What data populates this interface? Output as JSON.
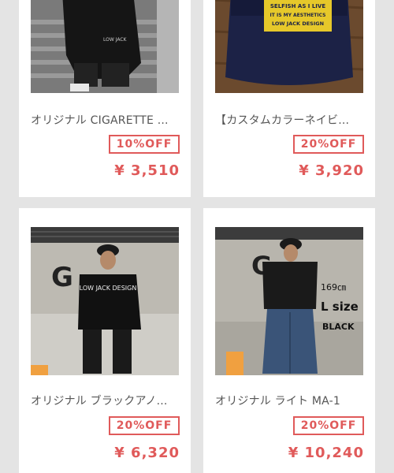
{
  "products": [
    {
      "title": "オリジナル CIGARETTE ...",
      "discount": "10%OFF",
      "price": "¥ 3,510"
    },
    {
      "title": "【カスタムカラーネイビ...",
      "discount": "20%OFF",
      "price": "¥ 3,920",
      "cap_text": [
        "SELFISH AS I LIVE",
        "IT IS MY AESTHETICS",
        "LOW JACK DESIGN"
      ]
    },
    {
      "title": "オリジナル ブラックアノ...",
      "discount": "20%OFF",
      "price": "¥ 6,320",
      "photo_text": "LOW JACK DESIGN",
      "wall_letter": "G"
    },
    {
      "title": "オリジナル ライト MA-1",
      "discount": "20%OFF",
      "price": "¥ 10,240",
      "wall_letter": "G",
      "model_height": "169㎝",
      "size_label": "L size",
      "color_label": "BLACK"
    }
  ],
  "colors": {
    "accent": "#e05a5a",
    "background": "#e4e4e4",
    "card": "#ffffff"
  }
}
